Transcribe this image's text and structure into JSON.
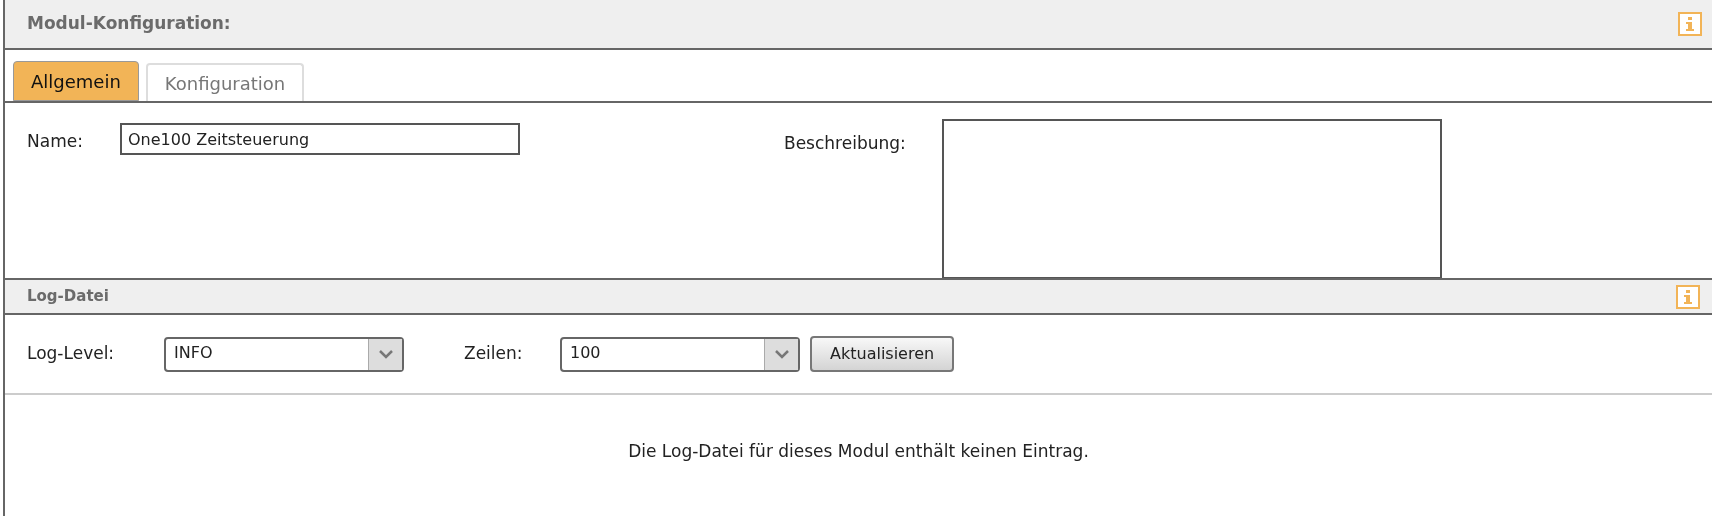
{
  "header": {
    "title": "Modul-Konfiguration:"
  },
  "tabs": [
    {
      "label": "Allgemein",
      "selected": true
    },
    {
      "label": "Konfiguration",
      "selected": false
    }
  ],
  "form": {
    "name_label": "Name:",
    "name_value": "One100 Zeitsteuerung",
    "description_label": "Beschreibung:"
  },
  "log": {
    "title": "Log-Datei",
    "level_label": "Log-Level:",
    "level_value": "INFO",
    "lines_label": "Zeilen:",
    "lines_value": "100",
    "refresh_button": "Aktualisieren",
    "message": "Die Log-Datei für dieses Modul enthält keinen Eintrag."
  }
}
